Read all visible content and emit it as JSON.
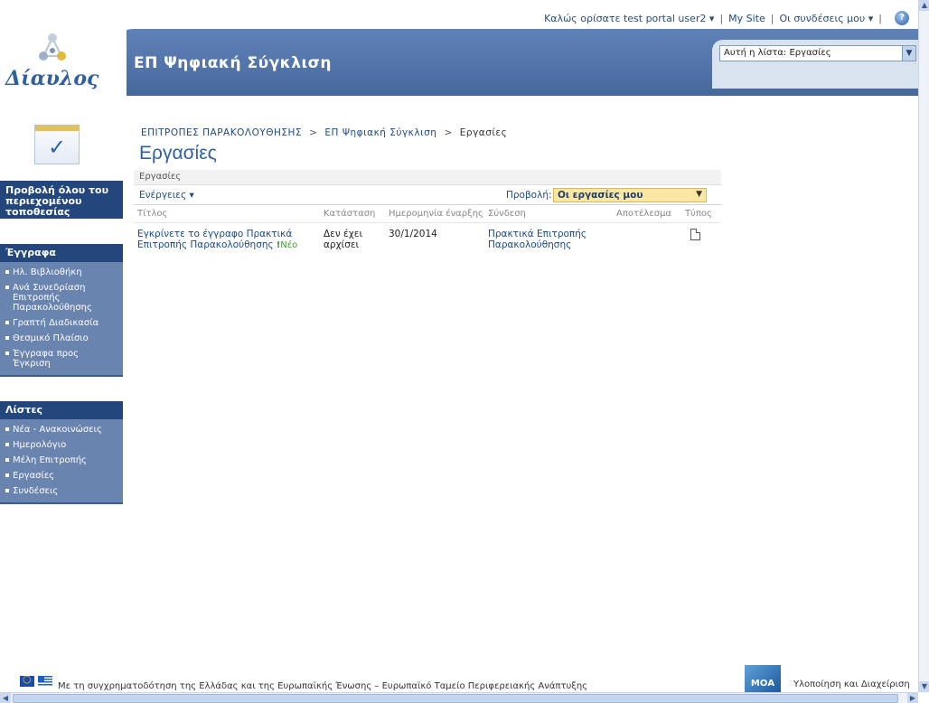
{
  "topbar": {
    "welcome": "Καλώς ορίσατε test portal user2",
    "my_site": "My Site",
    "my_links": "Οι συνδέσεις μου",
    "separator": "|"
  },
  "header": {
    "logo_text": "Δίαυλος",
    "site_title": "ΕΠ Ψηφιακή Σύγκλιση",
    "search_scope": "Αυτή η λίστα: Εργασίες"
  },
  "leftnav": {
    "view_all": "Προβολή όλου του περιεχομένου τοποθεσίας",
    "documents_heading": "Έγγραφα",
    "documents_items": [
      {
        "label": "Ηλ. Βιβλιοθήκη"
      },
      {
        "label": "Ανά Συνεδρίαση Επιτροπής Παρακολούθησης"
      },
      {
        "label": "Γραπτή Διαδικασία"
      },
      {
        "label": "Θεσμικό Πλαίσιο"
      },
      {
        "label": "Έγγραφα προς Έγκριση"
      }
    ],
    "lists_heading": "Λίστες",
    "lists_items": [
      {
        "label": "Νέα - Ανακοινώσεις"
      },
      {
        "label": "Ημερολόγιο"
      },
      {
        "label": "Μέλη Επιτροπής"
      },
      {
        "label": "Εργασίες"
      },
      {
        "label": "Συνδέσεις"
      }
    ]
  },
  "main": {
    "breadcrumb": [
      "ΕΠΙΤΡΟΠΕΣ ΠΑΡΑΚΟΛΟΥΘΗΣΗΣ",
      "ΕΠ Ψηφιακή Σύγκλιση",
      "Εργασίες"
    ],
    "breadcrumb_arrow": ">",
    "page_title": "Εργασίες",
    "list_label": "Εργασίες",
    "actions_label": "Ενέργειες",
    "view_label": "Προβολή:",
    "view_selected": "Οι εργασίες μου",
    "columns": [
      "Τίτλος",
      "Κατάσταση",
      "Ημερομηνία έναρξης",
      "Σύνδεση",
      "Αποτέλεσμα",
      "Τύπος"
    ],
    "rows": [
      {
        "title": "Εγκρίνετε το έγγραφο Πρακτικά Επιτροπής Παρακολούθησης",
        "new_badge": "Νέο",
        "status": "Δεν έχει αρχίσει",
        "start_date": "30/1/2014",
        "link": "Πρακτικά Επιτροπής Παρακολούθησης",
        "outcome": "",
        "type_icon": "document-icon"
      }
    ]
  },
  "footer": {
    "funding_text": "Με τη συγχρηματοδότηση της Ελλάδας και της Ευρωπαϊκής Ένωσης – Ευρωπαϊκό Ταμείο Περιφερειακής Ανάπτυξης",
    "moa_logo": "ΜΟΑ",
    "implementation_text": "Υλοποίηση και Διαχείριση"
  },
  "colors": {
    "header_band": "#5173a8",
    "nav_heading": "#23477c",
    "nav_group": "#6a84b0",
    "title_blue": "#2f5f9e",
    "view_select": "#fbe7a4",
    "new_green": "#3c9a2c"
  }
}
